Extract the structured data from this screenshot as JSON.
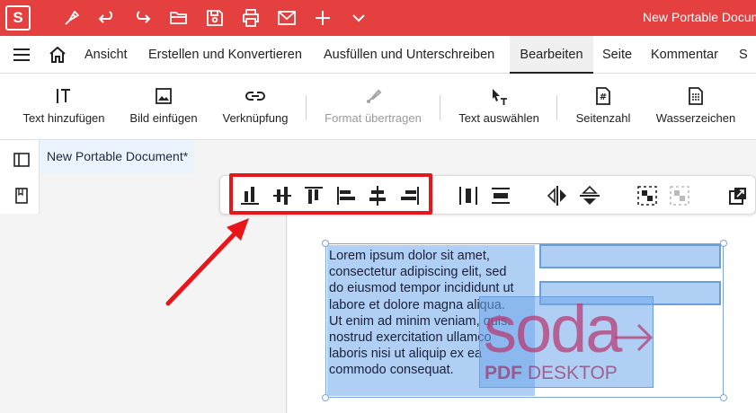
{
  "titlebar": {
    "logo_letter": "S",
    "window_title": "New Portable Document"
  },
  "menubar": {
    "tabs": [
      {
        "label": "Ansicht"
      },
      {
        "label": "Erstellen und Konvertieren"
      },
      {
        "label": "Ausfüllen und Unterschreiben"
      },
      {
        "label": "Bearbeiten",
        "active": true
      },
      {
        "label": "Seite"
      },
      {
        "label": "Kommentar"
      },
      {
        "label": "S"
      }
    ]
  },
  "ribbon": {
    "buttons": [
      {
        "label": "Text hinzufügen",
        "icon": "text-add-icon"
      },
      {
        "label": "Bild einfügen",
        "icon": "image-icon"
      },
      {
        "label": "Verknüpfung",
        "icon": "link-icon"
      },
      {
        "label": "Format übertragen",
        "icon": "format-brush-icon",
        "disabled": true
      },
      {
        "label": "Text auswählen",
        "icon": "text-select-icon"
      },
      {
        "label": "Seitenzahl",
        "icon": "page-number-icon"
      },
      {
        "label": "Wasserzeichen",
        "icon": "watermark-icon"
      }
    ]
  },
  "document": {
    "tab_title": "New Portable Document*",
    "lorem_text": "Lorem ipsum dolor sit amet,\nconsectetur adipiscing elit, sed\ndo eiusmod tempor incididunt ut\nlabore et dolore magna aliqua.\nUt enim ad minim veniam, quis\nnostrud exercitation ullamco\nlaboris nisi ut aliquip ex ea\ncommodo consequat.",
    "logo_word": "soda",
    "logo_pdf": "PDF",
    "logo_desktop": " DESKTOP"
  },
  "float_toolbar": {
    "align_icons": [
      "align-bottom-icon",
      "align-middle-icon",
      "align-top-icon",
      "align-left-icon",
      "align-center-icon",
      "align-right-icon"
    ],
    "other_icons": [
      "distribute-horizontal-icon",
      "distribute-vertical-icon",
      "flip-horizontal-icon",
      "flip-vertical-icon",
      "group-icon",
      "ungroup-icon",
      "open-external-icon"
    ]
  },
  "colors": {
    "brand_red": "#e4403f",
    "highlight_red": "#e8161b",
    "selection_blue": "#6ea8eb",
    "logo_magenta": "#b9326e"
  }
}
